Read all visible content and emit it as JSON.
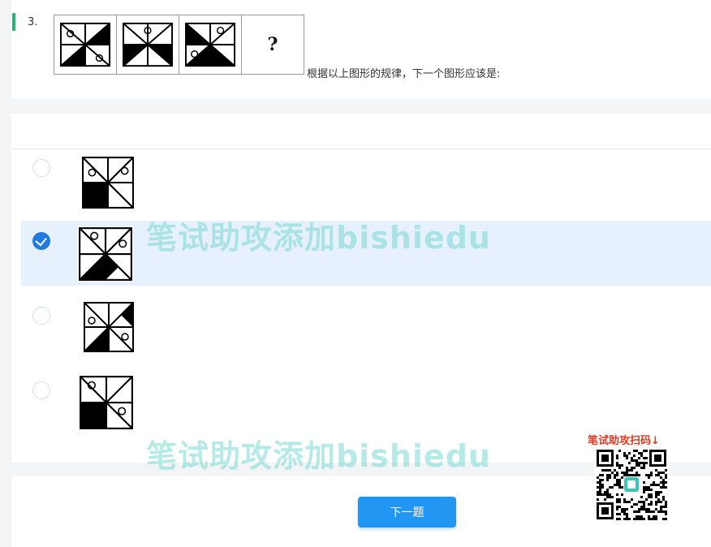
{
  "question": {
    "number": "3.",
    "prompt": "根据以上图形的规律，下一个图形应该是:",
    "sequence_placeholder": "?"
  },
  "options": [
    {
      "id": "A",
      "selected": false
    },
    {
      "id": "B",
      "selected": true
    },
    {
      "id": "C",
      "selected": false
    },
    {
      "id": "D",
      "selected": false
    }
  ],
  "watermark": {
    "text": "笔试助攻添加bishiedu"
  },
  "footer": {
    "next_button": "下一题"
  },
  "qr": {
    "label": "笔试助攻扫码↓"
  },
  "colors": {
    "accent": "#22b573",
    "primary": "#2196f3",
    "selected_row": "#e7f1fd",
    "watermark": "#6cd6d0",
    "qr_label": "#e8371d"
  }
}
